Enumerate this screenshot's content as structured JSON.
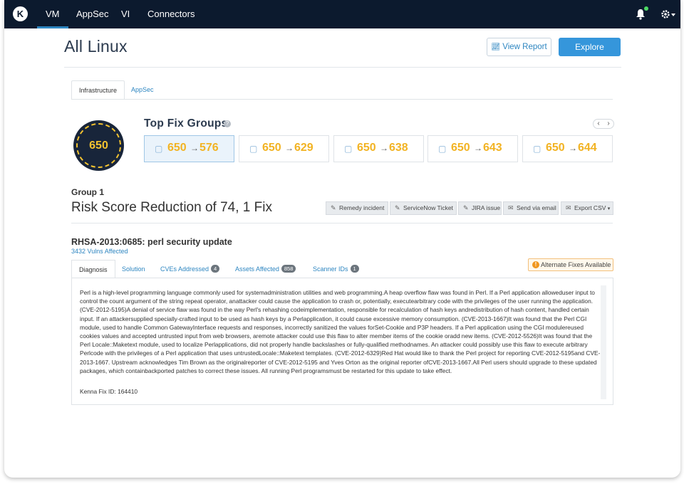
{
  "nav": {
    "items": [
      "VM",
      "AppSec",
      "VI",
      "Connectors"
    ],
    "active": "VM",
    "logo_letter": "K",
    "icons": [
      "bell-icon",
      "gear-icon"
    ]
  },
  "header": {
    "title": "All Linux",
    "view_report": "View Report",
    "explore": "Explore"
  },
  "tabs": [
    "Infrastructure",
    "AppSec"
  ],
  "score": "650",
  "top_fix_groups": {
    "title": "Top Fix Groups",
    "cards": [
      {
        "from": "650",
        "to": "576"
      },
      {
        "from": "650",
        "to": "629"
      },
      {
        "from": "650",
        "to": "638"
      },
      {
        "from": "650",
        "to": "643"
      },
      {
        "from": "650",
        "to": "644"
      }
    ]
  },
  "group": {
    "label": "Group 1",
    "title": "Risk Score Reduction of 74, 1 Fix",
    "actions": [
      "Remedy incident",
      "ServiceNow Ticket",
      "JIRA issue",
      "Send via email",
      "Export CSV"
    ]
  },
  "fix": {
    "title": "RHSA-2013:0685: perl security update",
    "vulns": "3432 Vulns Affected",
    "alternate": "Alternate Fixes Available",
    "tabs": {
      "diagnosis": "Diagnosis",
      "solution": "Solution",
      "cves": "CVEs Addressed",
      "cves_count": "4",
      "assets": "Assets Affected",
      "assets_count": "858",
      "scanners": "Scanner IDs",
      "scanners_count": "1"
    },
    "diagnosis_text": "Perl is a high-level programming language commonly used for systemadministration utilities and web programming.A heap overflow flaw was found in Perl. If a Perl application alloweduser input to control the count argument of the string repeat operator, anattacker could cause the application to crash or, potentially, executearbitrary code with the privileges of the user running the application.(CVE-2012-5195)A denial of service flaw was found in the way Perl's rehashing codeimplementation, responsible for recalculation of hash keys andredistribution of hash content, handled certain input. If an attackersupplied specially-crafted input to be used as hash keys by a Perlapplication, it could cause excessive memory consumption. (CVE-2013-1667)It was found that the Perl CGI module, used to handle Common GatewayInterface requests and responses, incorrectly sanitized the values forSet-Cookie and P3P headers. If a Perl application using the CGI modulereused cookies values and accepted untrusted input from web browsers, aremote attacker could use this flaw to alter member items of the cookie oradd new items. (CVE-2012-5526)It was found that the Perl Locale::Maketext module, used to localize Perlapplications, did not properly handle backslashes or fully-qualified methodnames. An attacker could possibly use this flaw to execute arbitrary Perlcode with the privileges of a Perl application that uses untrustedLocale::Maketext templates. (CVE-2012-6329)Red Hat would like to thank the Perl project for reporting CVE-2012-5195and CVE-2013-1667. Upstream acknowledges Tim Brown as the originalreporter of CVE-2012-5195 and Yves Orton as the original reporter ofCVE-2013-1667.All Perl users should upgrade to these updated packages, which containbackported patches to correct these issues. All running Perl programsmust be restarted for this update to take effect.",
    "fix_id": "Kenna Fix ID: 164410"
  }
}
